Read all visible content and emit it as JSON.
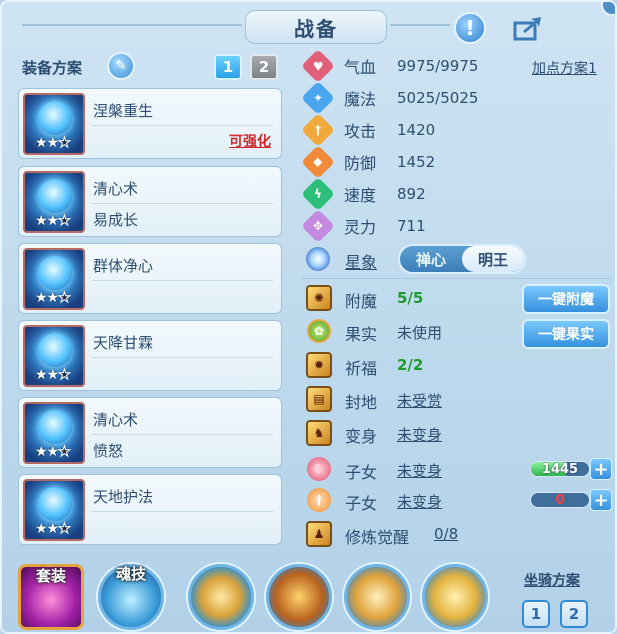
{
  "header": {
    "title": "战备",
    "alert_icon": "exclamation-icon",
    "share_icon": "share-icon"
  },
  "plans": {
    "label": "装备方案",
    "tabs": [
      "1",
      "2"
    ],
    "active_tab": "1"
  },
  "cards": [
    {
      "name": "涅槃重生",
      "sub": "",
      "upgrade": "可强化",
      "stars": 2,
      "max_stars": 3
    },
    {
      "name": "清心术",
      "sub": "易成长",
      "upgrade": "",
      "stars": 2,
      "max_stars": 3
    },
    {
      "name": "群体净心",
      "sub": "",
      "upgrade": "",
      "stars": 2,
      "max_stars": 3
    },
    {
      "name": "天降甘霖",
      "sub": "",
      "upgrade": "",
      "stars": 2,
      "max_stars": 3
    },
    {
      "name": "清心术",
      "sub": "愤怒",
      "upgrade": "",
      "stars": 2,
      "max_stars": 3
    },
    {
      "name": "天地护法",
      "sub": "",
      "upgrade": "",
      "stars": 2,
      "max_stars": 3
    }
  ],
  "stats": {
    "plus_plan": "加点方案1",
    "rows": [
      {
        "label": "气血",
        "value": "9975/9975",
        "color": "#e0607a",
        "icon": "♥"
      },
      {
        "label": "魔法",
        "value": "5025/5025",
        "color": "#49a6ef",
        "icon": "✦"
      },
      {
        "label": "攻击",
        "value": "1420",
        "color": "#f0a93a",
        "icon": "†"
      },
      {
        "label": "防御",
        "value": "1452",
        "color": "#f08a3a",
        "icon": "◆"
      },
      {
        "label": "速度",
        "value": "892",
        "color": "#2dbf7a",
        "icon": "ϟ"
      },
      {
        "label": "灵力",
        "value": "711",
        "color": "#c48ae0",
        "icon": "✥"
      }
    ]
  },
  "star_sign": {
    "label": "星象",
    "options": [
      "禅心",
      "明王"
    ],
    "selected": "明王"
  },
  "extras": {
    "enchant": {
      "label": "附魔",
      "value": "5/5"
    },
    "fruit": {
      "label": "果实",
      "value": "未使用"
    },
    "blessing": {
      "label": "祈福",
      "value": "2/2"
    },
    "fief": {
      "label": "封地",
      "value": "未受赏"
    },
    "transform": {
      "label": "变身",
      "value": "未变身"
    },
    "child1": {
      "label": "子女",
      "value": "未变身",
      "bar_value": "1445",
      "bar_fill": 0.6
    },
    "child2": {
      "label": "子女",
      "value": "未变身",
      "bar_value": "0",
      "bar_fill": 0
    },
    "awaken": {
      "label": "修炼觉醒",
      "value": "0/8"
    }
  },
  "buttons": {
    "enchant": "一键附魔",
    "fruit": "一键果实"
  },
  "bottom": {
    "suit_label": "套装",
    "skill_label": "魂技",
    "mount_label": "坐骑方案",
    "mount_tabs": [
      "1",
      "2"
    ]
  }
}
